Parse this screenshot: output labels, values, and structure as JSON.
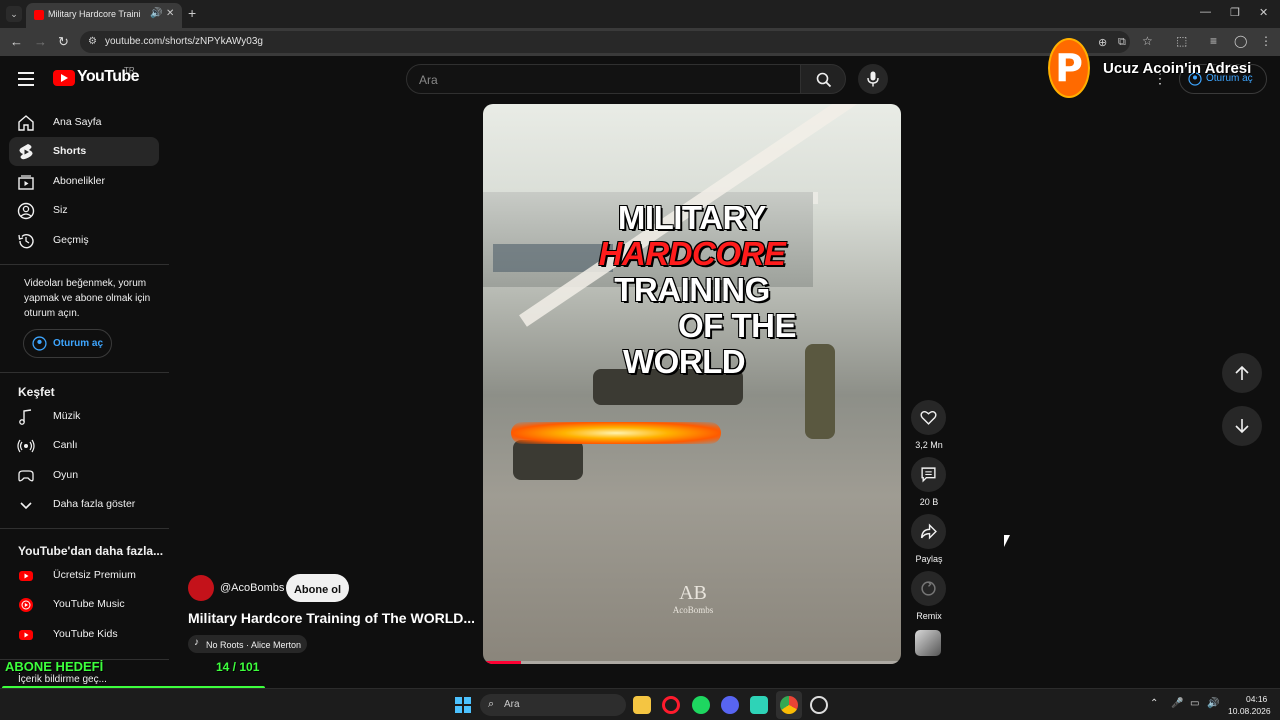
{
  "browser": {
    "tab_title": "Military Hardcore Training o",
    "url": "youtube.com/shorts/zNPYkAWy03g",
    "tab_audio_icon": "speaker-icon",
    "new_tab_label": "+"
  },
  "masthead": {
    "logo_text": "YouTube",
    "country_code": "TR",
    "search_placeholder": "Ara",
    "signin_label": "Oturum aç"
  },
  "sidebar": {
    "items": [
      {
        "label": "Ana Sayfa",
        "icon": "home-icon"
      },
      {
        "label": "Shorts",
        "icon": "shorts-icon",
        "active": true
      },
      {
        "label": "Abonelikler",
        "icon": "subscriptions-icon"
      },
      {
        "label": "Siz",
        "icon": "you-icon"
      },
      {
        "label": "Geçmiş",
        "icon": "history-icon"
      }
    ],
    "signin_prompt": "Videoları beğenmek, yorum yapmak ve abone olmak için oturum açın.",
    "signin_label": "Oturum aç",
    "explore_heading": "Keşfet",
    "explore_items": [
      {
        "label": "Müzik",
        "icon": "music-icon"
      },
      {
        "label": "Canlı",
        "icon": "live-icon"
      },
      {
        "label": "Oyun",
        "icon": "gaming-icon"
      },
      {
        "label": "Daha fazla göster",
        "icon": "chevron-down-icon"
      }
    ],
    "more_heading": "YouTube'dan daha fazla...",
    "more_items": [
      {
        "label": "Ücretsiz Premium",
        "icon": "youtube-premium-icon"
      },
      {
        "label": "YouTube Music",
        "icon": "youtube-music-icon"
      },
      {
        "label": "YouTube Kids",
        "icon": "youtube-kids-icon"
      }
    ],
    "feedback_label": "İçerik bildirme geç..."
  },
  "short": {
    "overlay_lines": [
      "MILITARY",
      "HARDCORE",
      "TRAINING",
      "OF THE",
      "WORLD"
    ],
    "watermark_logo": "AB",
    "watermark_text": "AcoBombs",
    "progress": 0.09,
    "channel": "@AcoBombs",
    "subscribe_label": "Abone ol",
    "title": "Military Hardcore Training of The WORLD...",
    "music": "No Roots · Alice Merton"
  },
  "actions": {
    "like_count": "3,2 Mn",
    "comment_count": "20 B",
    "share_label": "Paylaş",
    "remix_label": "Remix"
  },
  "stream_overlay": {
    "logo_letter": "P",
    "banner": "Ucuz Acoin'in Adresi",
    "goal_label": "ABONE HEDEFİ",
    "goal_count": "14 / 101",
    "goal_progress": 0.139
  },
  "taskbar": {
    "search_label": "Ara",
    "time": "04:16",
    "date": "10.08.2026"
  },
  "colors": {
    "youtube_red": "#ff0000",
    "link_blue": "#3ea6ff",
    "goal_green": "#3dff3d",
    "title_red": "#ff1c1c"
  }
}
